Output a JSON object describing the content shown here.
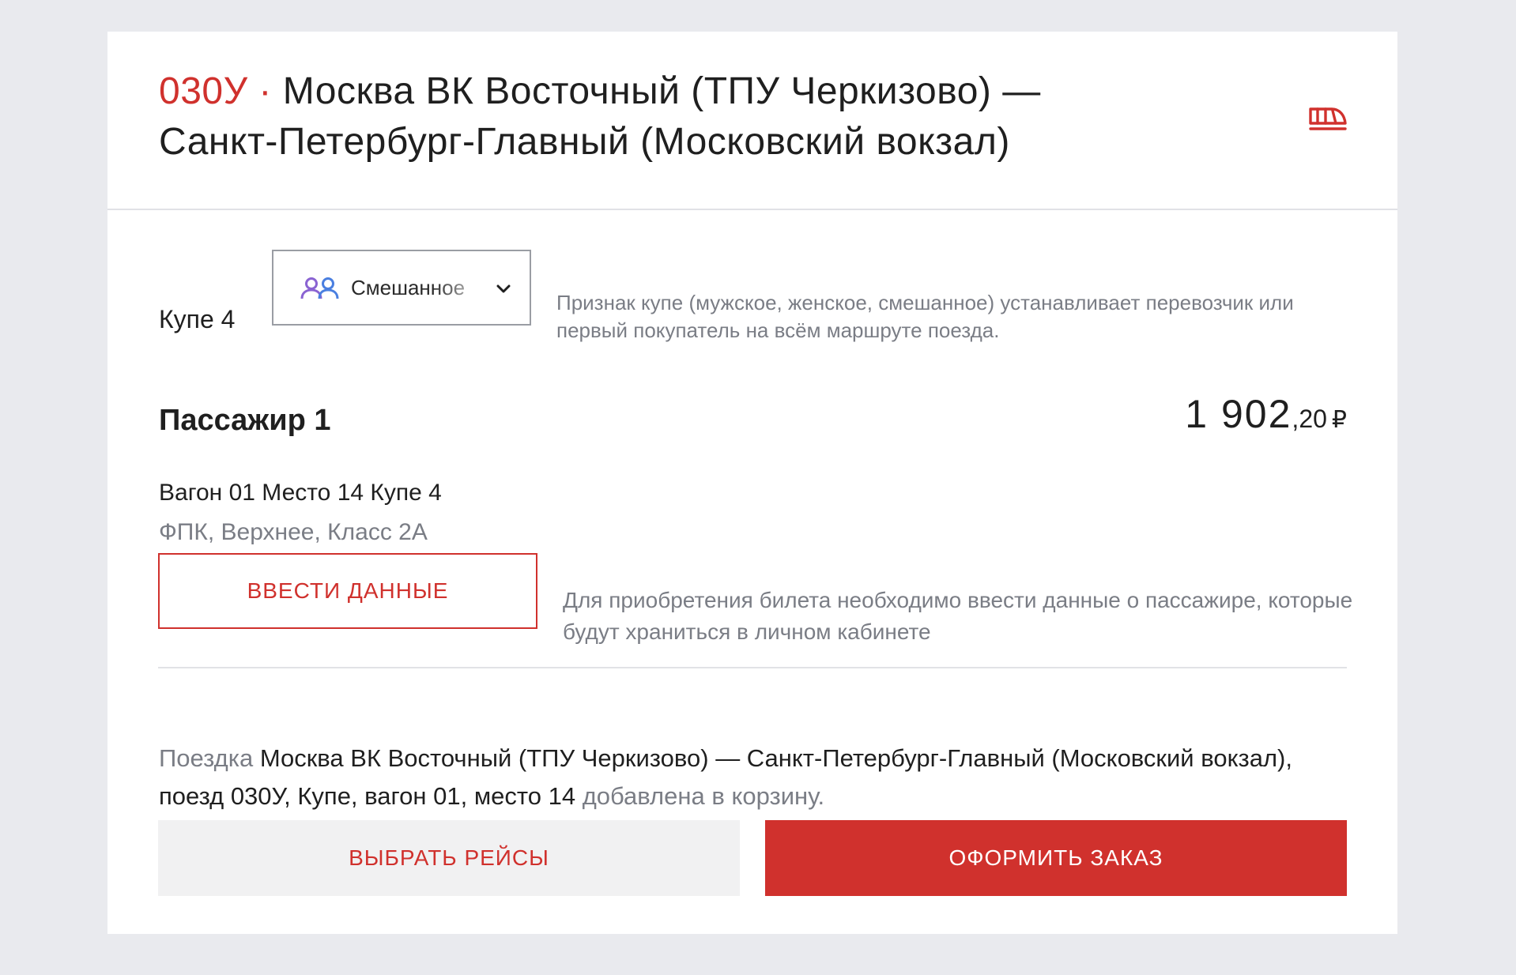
{
  "header": {
    "train_code": "030У",
    "separator": "·",
    "route_line_1": "Москва ВК Восточный (ТПУ Черкизово) —",
    "route_line_2": "Санкт-Петербург-Главный (Московский вокзал)",
    "icon": "train-icon"
  },
  "compartment": {
    "label": "Купе 4",
    "select": {
      "icon": "people-icon",
      "value": "Смешанное",
      "chevron": "chevron-down-icon"
    },
    "hint": "Признак купе (мужское, женское, смешанное) устанавливает перевозчик или первый покупатель на всём маршруте поезда."
  },
  "passenger": {
    "title": "Пассажир 1",
    "price_main": "1 902",
    "price_fraction": ",20",
    "price_currency": "₽",
    "seat_info": "Вагон 01 Место 14 Купе 4",
    "seat_details": "ФПК, Верхнее, Класс 2А",
    "enter_data_button": "ВВЕСТИ ДАННЫЕ",
    "enter_data_hint": "Для приобретения билета необходимо ввести данные о пассажире, которые будут храниться в личном кабинете"
  },
  "cart_message": {
    "prefix": "Поездка",
    "body": "Москва ВК Восточный (ТПУ Черкизово) — Санкт-Петербург-Главный (Московский вокзал), поезд 030У, Купе, вагон 01, место 14",
    "suffix": "добавлена в корзину."
  },
  "actions": {
    "choose_trips": "ВЫБРАТЬ РЕЙСЫ",
    "place_order": "ОФОРМИТЬ ЗАКАЗ"
  },
  "colors": {
    "accent": "#d0312d",
    "muted_text": "#7a7d85",
    "background": "#e9eaee",
    "people_icon_purple": "#8a63d2",
    "people_icon_blue": "#4a7fe0"
  }
}
